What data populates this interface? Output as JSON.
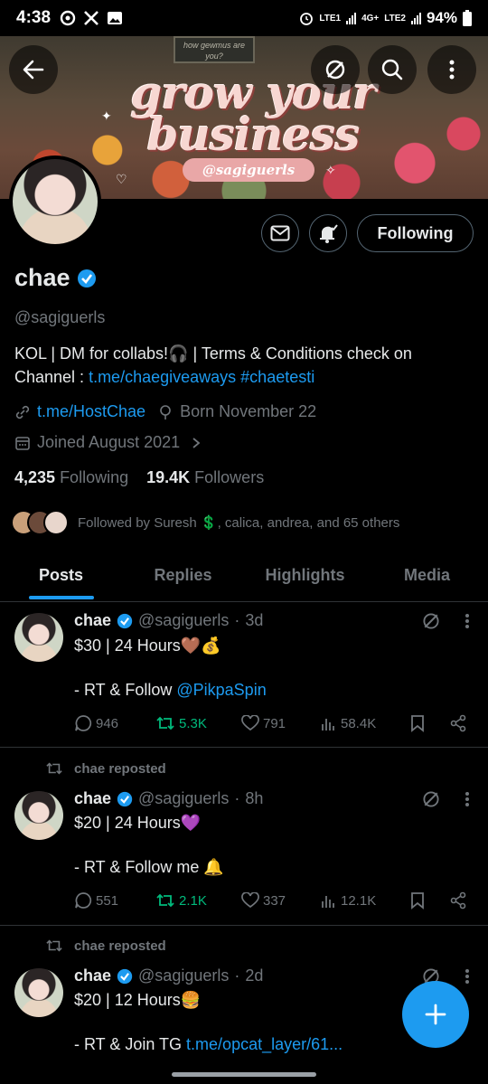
{
  "status_bar": {
    "time": "4:38",
    "net1": "LTE1",
    "net2": "LTE2",
    "net_4g": "4G+",
    "battery": "94%"
  },
  "banner": {
    "sign_text": "how gewmus are you?",
    "title_line1": "grow your",
    "title_line2": "business",
    "handle": "@sagiguerls"
  },
  "profile": {
    "display_name": "chae",
    "username": "@sagiguerls",
    "bio_prefix": "KOL | DM for collabs!🎧 | Terms & Conditions check on Channel : ",
    "bio_link": "t.me/chaegiveaways",
    "bio_hashtag": "#chaetesti",
    "website": "t.me/HostChae",
    "born": "Born November 22",
    "joined": "Joined August 2021",
    "following_count": "4,235",
    "following_label": "Following",
    "followers_count": "19.4K",
    "followers_label": "Followers",
    "followed_by": "Followed by Suresh 💲, calica, andrea, and 65 others",
    "following_button": "Following"
  },
  "tabs": [
    "Posts",
    "Replies",
    "Highlights",
    "Media"
  ],
  "active_tab": "Posts",
  "tweets": [
    {
      "repost_label": "",
      "name": "chae",
      "handle": "@sagiguerls",
      "time": "3d",
      "line1": "$30 | 24 Hours🤎💰",
      "line2_prefix": "- RT & Follow ",
      "line2_link": "@PikpaSpin",
      "replies": "946",
      "reposts": "5.3K",
      "likes": "791",
      "views": "58.4K"
    },
    {
      "repost_label": "chae reposted",
      "name": "chae",
      "handle": "@sagiguerls",
      "time": "8h",
      "line1": "$20 | 24 Hours💜",
      "line2_prefix": "- RT & Follow me 🔔",
      "line2_link": "",
      "replies": "551",
      "reposts": "2.1K",
      "likes": "337",
      "views": "12.1K"
    },
    {
      "repost_label": "chae reposted",
      "name": "chae",
      "handle": "@sagiguerls",
      "time": "2d",
      "line1": "$20 | 12 Hours🍔",
      "line2_prefix": "- RT & Join TG ",
      "line2_link": "t.me/opcat_layer/61..."
    }
  ],
  "colors": {
    "accent": "#1d9bf0",
    "repost_green": "#00ba7c",
    "muted": "#71767b",
    "text": "#e7e9ea",
    "background": "#000000"
  }
}
